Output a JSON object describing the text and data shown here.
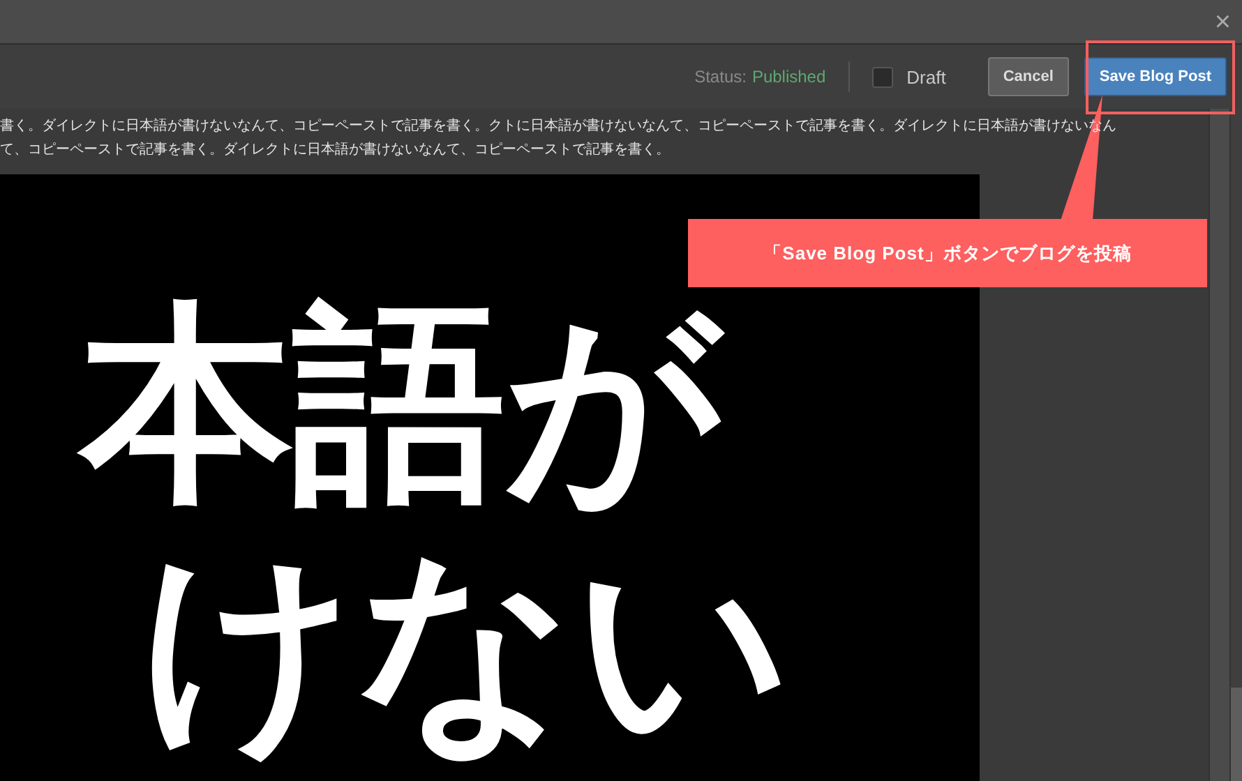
{
  "window": {
    "close_icon": "×"
  },
  "toolbar": {
    "status_label": "Status:",
    "status_value": "Published",
    "draft": {
      "label": "Draft",
      "checked": false
    },
    "buttons": [
      {
        "label": "Cancel",
        "kind": "secondary"
      },
      {
        "label": "Save Blog Post",
        "kind": "primary"
      }
    ]
  },
  "editor": {
    "text_lines": [
      "書く。ダイレクトに日本語が書けないなんて、コピーペーストで記事を書く。クトに日本語が書けないなんて、コピーペーストで記事を書く。ダイレクトに日本語が書けないなん",
      "て、コピーペーストで記事を書く。ダイレクトに日本語が書けないなんて、コピーペーストで記事を書く。"
    ],
    "image_lines": [
      "本語が",
      "けない"
    ]
  },
  "annotation": {
    "callout": "「Save Blog Post」ボタンでブログを投稿"
  }
}
